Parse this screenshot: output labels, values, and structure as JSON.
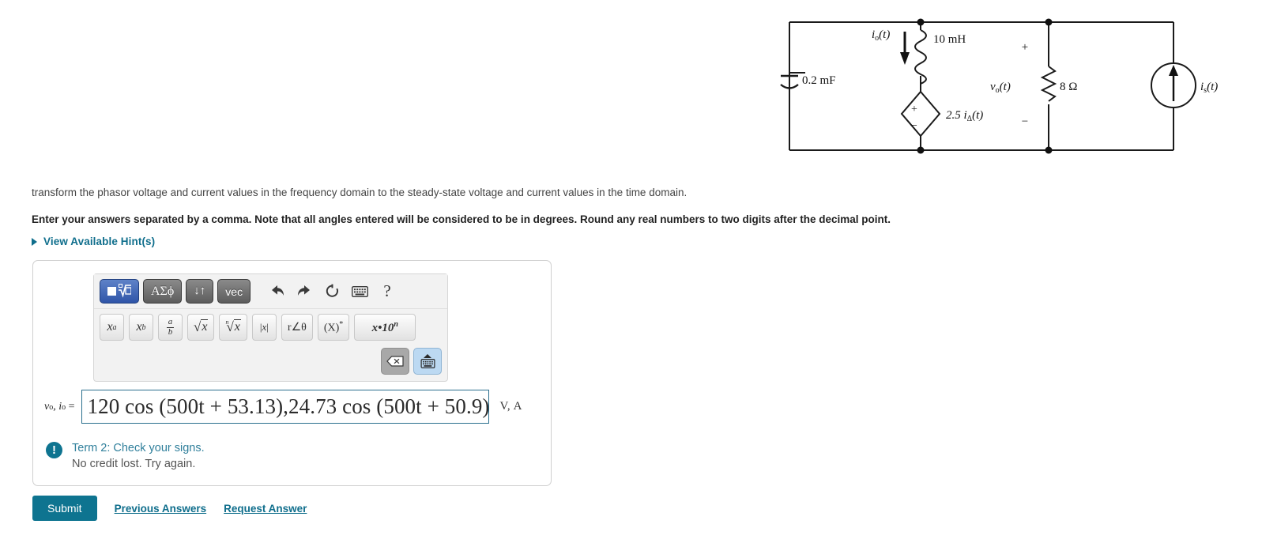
{
  "circuit": {
    "alt": "AC circuit with capacitor, inductor, dependent voltage source, resistor and current source",
    "labels": {
      "i_delta": "i",
      "i_delta_sub": "Δ",
      "i_delta_arg": "(t)",
      "capacitor": "0.2 mF",
      "i_o": "i",
      "i_o_sub": "o",
      "i_o_arg": "(t)",
      "inductor": "10 mH",
      "dep_source": "2.5 i",
      "dep_source_sub": "Δ",
      "dep_source_arg": "(t)",
      "dep_plus": "+",
      "dep_minus": "−",
      "v_o": "v",
      "v_o_sub": "o",
      "v_o_arg": "(t)",
      "resistor": "8 Ω",
      "res_plus": "+",
      "res_minus": "−",
      "i_s": "i",
      "i_s_sub": "s",
      "i_s_arg": "(t)"
    }
  },
  "problem": {
    "line1": "transform the phasor voltage and current values in the frequency domain to the steady-state voltage and current values in the time domain.",
    "line2": "Enter your answers separated by a comma. Note that all angles entered will be considered to be in degrees. Round any real numbers to two digits after the decimal point."
  },
  "hints": {
    "label": "View Available Hint(s)",
    "icon": "triangle-right-icon",
    "color": "#0f6e8c"
  },
  "toolbar": {
    "mode_buttons": [
      {
        "name": "template-mode-button",
        "label": "√",
        "active": true
      },
      {
        "name": "greek-symbols-button",
        "label": "ΑΣϕ",
        "active": false
      },
      {
        "name": "swap-arrows-button",
        "label": "↓↑",
        "active": false
      },
      {
        "name": "vector-button",
        "label": "vec",
        "active": false
      }
    ],
    "icon_buttons": [
      {
        "name": "undo-icon",
        "label": "↩"
      },
      {
        "name": "redo-icon",
        "label": "↪"
      },
      {
        "name": "reset-icon",
        "label": "↺"
      },
      {
        "name": "keyboard-icon",
        "label": "⌨"
      },
      {
        "name": "help-icon",
        "label": "?"
      }
    ],
    "template_buttons": [
      {
        "name": "superscript-button",
        "label": "x^a"
      },
      {
        "name": "subscript-button",
        "label": "x_b"
      },
      {
        "name": "fraction-button",
        "num": "a",
        "den": "b"
      },
      {
        "name": "square-root-button",
        "label": "√x"
      },
      {
        "name": "nth-root-button",
        "label": "n√x"
      },
      {
        "name": "absolute-value-button",
        "label": "|x|"
      },
      {
        "name": "polar-form-button",
        "label": "r∠θ"
      },
      {
        "name": "conjugate-button",
        "label": "(X)*"
      },
      {
        "name": "scientific-notation-button",
        "label": "x•10n"
      }
    ],
    "backspace": {
      "name": "backspace-button",
      "label": "⌫"
    },
    "keyboard_toggle": {
      "name": "keyboard-toggle-button",
      "label": "⌨"
    }
  },
  "answer": {
    "var_label": "v",
    "var_sub1": "o",
    "var_label2": "i",
    "var_sub2": "o",
    "equals": "=",
    "value": "120 cos (500t + 53.13),24.73 cos (500t + 50.9)",
    "units": "V, A",
    "border_color": "#2a6f8e"
  },
  "feedback": {
    "icon": "exclamation-icon",
    "title": "Term 2: Check your signs.",
    "subtitle": "No credit lost. Try again.",
    "title_color": "#2f7f9b"
  },
  "actions": {
    "submit_label": "Submit",
    "previous_answers_label": "Previous Answers",
    "request_answer_label": "Request Answer",
    "submit_color": "#0e7490"
  }
}
